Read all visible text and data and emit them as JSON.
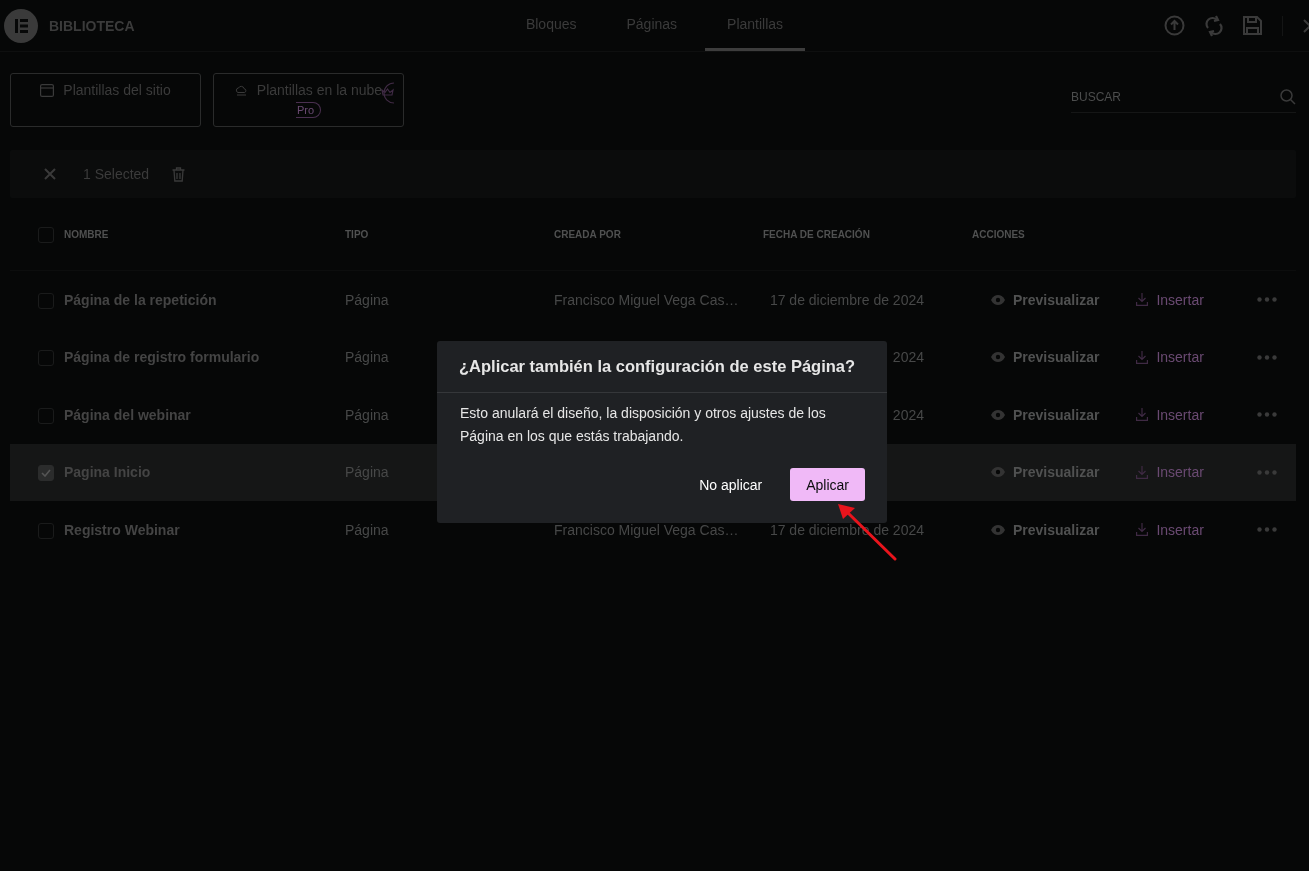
{
  "header": {
    "title": "BIBLIOTECA",
    "tabs": [
      {
        "label": "Bloques",
        "selected": false
      },
      {
        "label": "Páginas",
        "selected": false
      },
      {
        "label": "Plantillas",
        "selected": true
      }
    ]
  },
  "source_filters": [
    {
      "label": "Plantillas del sitio",
      "kind": "site"
    },
    {
      "label": "Plantillas en la nube",
      "kind": "cloud",
      "badge": "Pro"
    }
  ],
  "search": {
    "placeholder": "BUSCAR"
  },
  "selection_bar": {
    "count": "1 Selected"
  },
  "table": {
    "select_all": {
      "checked": false
    },
    "columns": [
      "NOMBRE",
      "TIPO",
      "CREADA POR",
      "FECHA DE CREACIÓN",
      "ACCIONES"
    ],
    "rows": [
      {
        "checked": false,
        "selected": false,
        "name": "Página de la repetición",
        "type": "Página",
        "author": "Francisco Miguel Vega Cas…",
        "date": "17 de diciembre de 2024",
        "preview": "Previsualizar",
        "insert": "Insertar"
      },
      {
        "checked": false,
        "selected": false,
        "name": "Página de registro formulario",
        "type": "Página",
        "date": "2024",
        "preview": "Previsualizar",
        "insert": "Insertar"
      },
      {
        "checked": false,
        "selected": false,
        "name": "Página del webinar",
        "type": "Página",
        "date": "2024",
        "preview": "Previsualizar",
        "insert": "Insertar"
      },
      {
        "checked": true,
        "selected": true,
        "name": "Pagina Inicio",
        "type": "Página",
        "preview": "Previsualizar",
        "insert": "Insertar"
      },
      {
        "checked": false,
        "selected": false,
        "name": "Registro Webinar",
        "type": "Página",
        "author": "Francisco Miguel Vega Cas…",
        "date": "17 de diciembre de 2024",
        "preview": "Previsualizar",
        "insert": "Insertar"
      }
    ]
  },
  "dialog": {
    "title": "¿Aplicar también la configuración de este Página?",
    "message": "Esto anulará el diseño, la disposición y otros ajustes de los Página en los que estás trabajando.",
    "buttons": [
      {
        "label": "No aplicar",
        "kind": "secondary"
      },
      {
        "label": "Aplicar",
        "kind": "primary"
      }
    ]
  }
}
